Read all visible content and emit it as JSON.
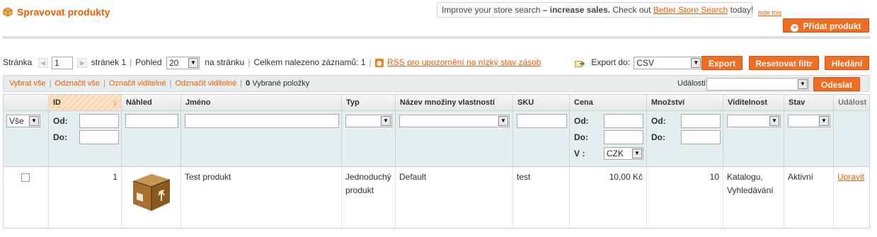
{
  "header": {
    "title": "Spravovat produkty",
    "notice_pre": "Improve your store search ",
    "notice_bold": "– increase sales.",
    "notice_mid": " Check out ",
    "notice_link": "Better Store Search",
    "notice_post": " today!",
    "hide_this": "hide this",
    "add_product": "Přidat produkt"
  },
  "pager": {
    "page_label": "Stránka",
    "page_value": "1",
    "pages_of": "stránek 1",
    "view_label": "Pohled",
    "per_page": "20",
    "per_page_suffix": "na stránku",
    "total": "Celkem nalezeno záznamů: 1",
    "rss_link": "RSS pro upozornění na nízký stav zásob",
    "export_label": "Export do:",
    "export_format": "CSV",
    "export_btn": "Export",
    "reset_btn": "Resetovat filtr",
    "search_btn": "Hledání"
  },
  "massaction": {
    "select_all": "Vybrat vše",
    "unselect_all": "Odznačit vše",
    "select_visible": "Označit viditelné",
    "unselect_visible": "Odznačit viditelné",
    "selected_count": "0",
    "selected_label": "Vybrané položky",
    "actions_label": "Události",
    "submit": "Odeslat"
  },
  "columns": [
    "ID",
    "Náhled",
    "Jméno",
    "Typ",
    "Název množiny vlastností",
    "SKU",
    "Cena",
    "Množství",
    "Viditelnost",
    "Stav",
    "Událost"
  ],
  "filters": {
    "massaction_select": "Vše",
    "from": "Od:",
    "to": "Do:",
    "currency_label": "V :",
    "currency": "CZK"
  },
  "rows": [
    {
      "id": "1",
      "name": "Test produkt",
      "type": "Jednoduchý produkt",
      "attribute_set": "Default",
      "sku": "test",
      "price": "10,00 Kč",
      "qty": "10",
      "visibility": "Katalogu, Vyhledávání",
      "status": "Aktivní",
      "action": "Upravit"
    }
  ],
  "colors": {
    "accent": "#eb5e00",
    "button": "#f26c21",
    "filter_bg": "#e3eef0"
  }
}
